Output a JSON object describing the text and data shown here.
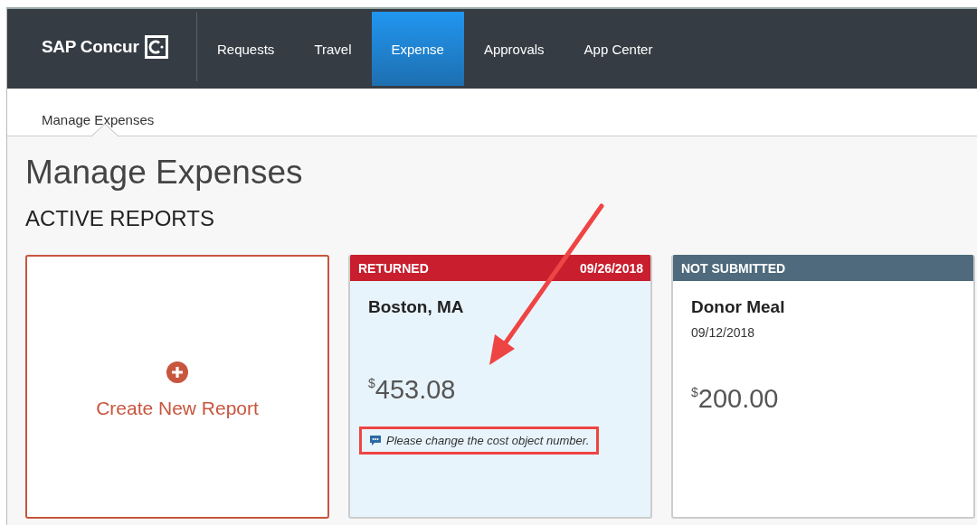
{
  "nav": {
    "logo": "SAP Concur",
    "tabs": [
      {
        "label": "Requests",
        "selected": false
      },
      {
        "label": "Travel",
        "selected": false
      },
      {
        "label": "Expense",
        "selected": true
      },
      {
        "label": "Approvals",
        "selected": false
      },
      {
        "label": "App Center",
        "selected": false
      }
    ]
  },
  "subnav": {
    "items": [
      {
        "label": "Manage Expenses",
        "selected": true
      }
    ]
  },
  "page": {
    "title": "Manage Expenses",
    "section": "ACTIVE REPORTS"
  },
  "cards": [
    {
      "kind": "create",
      "label": "Create New Report"
    },
    {
      "kind": "report",
      "selected": true,
      "status": {
        "label": "RETURNED",
        "date": "09/26/2018",
        "color": "#c81e2d"
      },
      "name": "Boston, MA",
      "currency": "$",
      "amount": "453.08",
      "comment": {
        "text": "Please change the cost object number.",
        "highlighted": true
      }
    },
    {
      "kind": "report",
      "selected": false,
      "status": {
        "label": "NOT SUBMITTED",
        "color": "#4e6a7c"
      },
      "name": "Donor Meal",
      "date": "09/12/2018",
      "currency": "$",
      "amount": "200.00"
    }
  ],
  "annotation_arrow": true
}
